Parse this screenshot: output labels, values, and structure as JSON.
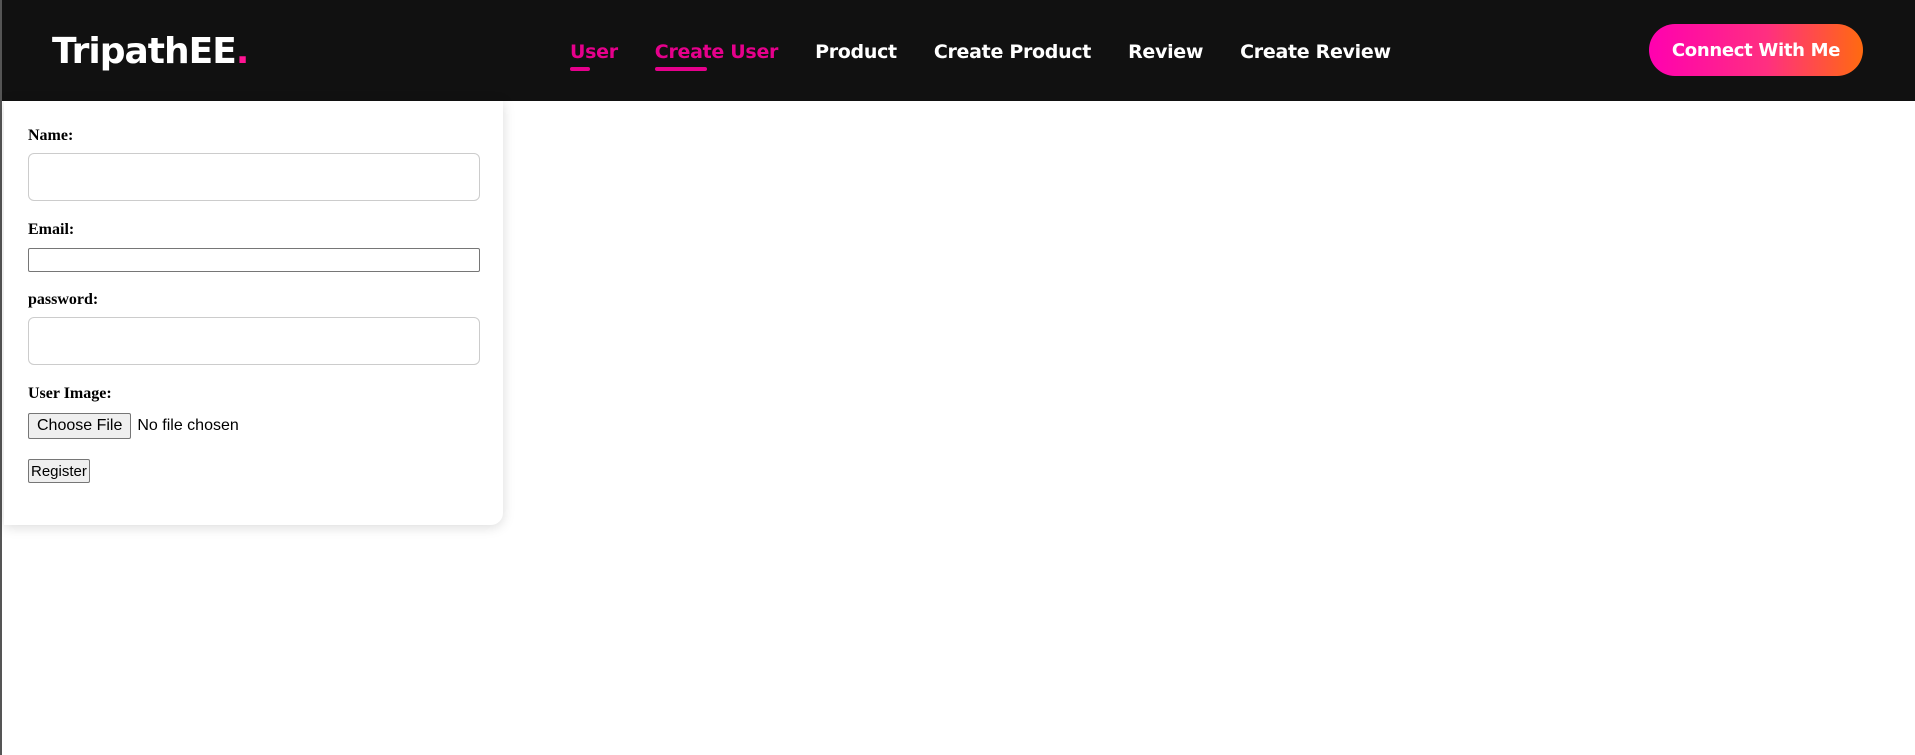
{
  "brand": {
    "name": "TripathEE",
    "dot": ".",
    "dot_color": "#ff1493"
  },
  "nav": {
    "items": [
      {
        "label": "User",
        "active": true
      },
      {
        "label": "Create User",
        "active": true
      },
      {
        "label": "Product",
        "active": false
      },
      {
        "label": "Create Product",
        "active": false
      },
      {
        "label": "Review",
        "active": false
      },
      {
        "label": "Create Review",
        "active": false
      }
    ],
    "active_color": "#e6008c",
    "background": "#111111"
  },
  "cta": {
    "label": "Connect With Me",
    "gradient": [
      "#ff00b0",
      "#ff6a10"
    ]
  },
  "form": {
    "name_label": "Name:",
    "name_value": "",
    "email_label": "Email:",
    "email_value": "",
    "password_label": "password:",
    "password_value": "",
    "image_label": "User Image:",
    "file_button": "Choose File",
    "file_status": "No file chosen",
    "submit_label": "Register"
  }
}
